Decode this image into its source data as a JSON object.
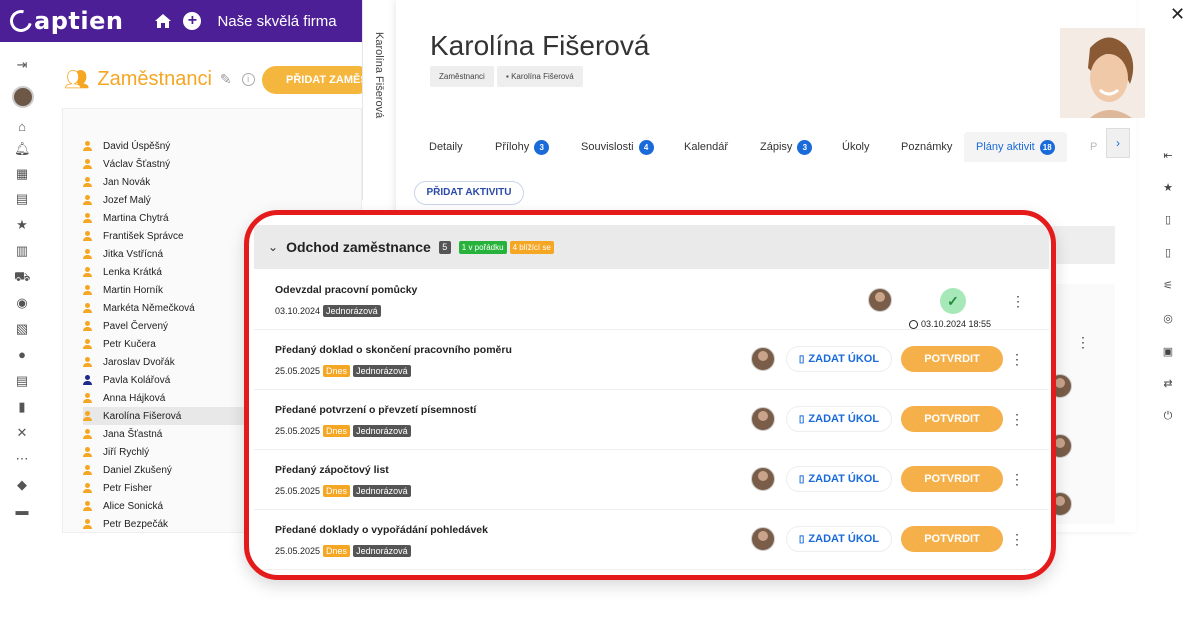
{
  "app": {
    "logo": "aptien",
    "company": "Naše skvělá firma"
  },
  "employees": {
    "title": "Zaměstnanci",
    "add_button": "PŘIDAT ZAMĚSTNANCE",
    "list": [
      "David Úspěšný",
      "Václav Šťastný",
      "Jan Novák",
      "Jozef Malý",
      "Martina Chytrá",
      "František Správce",
      "Jitka Vstřícná",
      "Lenka Krátká",
      "Martin Horník",
      "Markéta Němečková",
      "Pavel Červený",
      "Petr Kučera",
      "Jaroslav Dvořák",
      "Pavla Kolářová",
      "Anna Hájková",
      "Karolína Fišerová",
      "Jana Šťastná",
      "Jiří Rychlý",
      "Daniel Zkušený",
      "Petr Fisher",
      "Alice Sonická",
      "Petr Bezpečák"
    ]
  },
  "person": {
    "vertical_tab": "Karolína Fišerová",
    "name": "Karolína Fišerová",
    "breadcrumbs": [
      "Zaměstnanci",
      "Karolína Fišerová"
    ],
    "tabs": [
      {
        "label": "Detaily",
        "badge": ""
      },
      {
        "label": "Přílohy",
        "badge": "3"
      },
      {
        "label": "Souvislosti",
        "badge": "4"
      },
      {
        "label": "Kalendář",
        "badge": ""
      },
      {
        "label": "Zápisy",
        "badge": "3"
      },
      {
        "label": "Úkoly",
        "badge": ""
      },
      {
        "label": "Poznámky",
        "badge": ""
      },
      {
        "label": "Plány aktivit",
        "badge": "18"
      },
      {
        "label": "P",
        "badge": ""
      }
    ],
    "add_activity": "PŘIDAT AKTIVITU"
  },
  "plan": {
    "title": "Odchod zaměstnance",
    "count": "5",
    "tag_in_order": "1 v pořádku",
    "tag_upcoming": "4 blížící se",
    "task_button": "ZADAT ÚKOL",
    "confirm_button": "POTVRDIT",
    "items": [
      {
        "title": "Odevzdal pracovní pomůcky",
        "date": "03.10.2024",
        "today": "",
        "type": "Jednorázová",
        "done_time": "03.10.2024 18:55"
      },
      {
        "title": "Předaný doklad o skončení pracovního poměru",
        "date": "25.05.2025",
        "today": "Dnes",
        "type": "Jednorázová"
      },
      {
        "title": "Předané potvrzení o převzetí písemností",
        "date": "25.05.2025",
        "today": "Dnes",
        "type": "Jednorázová"
      },
      {
        "title": "Předaný zápočtový list",
        "date": "25.05.2025",
        "today": "Dnes",
        "type": "Jednorázová"
      },
      {
        "title": "Předané doklady o vypořádání pohledávek",
        "date": "25.05.2025",
        "today": "Dnes",
        "type": "Jednorázová"
      }
    ]
  },
  "colors": {
    "brand": "#4d1f97",
    "accent": "#f5a623",
    "link": "#1a6ad9",
    "highlight": "#e51b1b"
  }
}
